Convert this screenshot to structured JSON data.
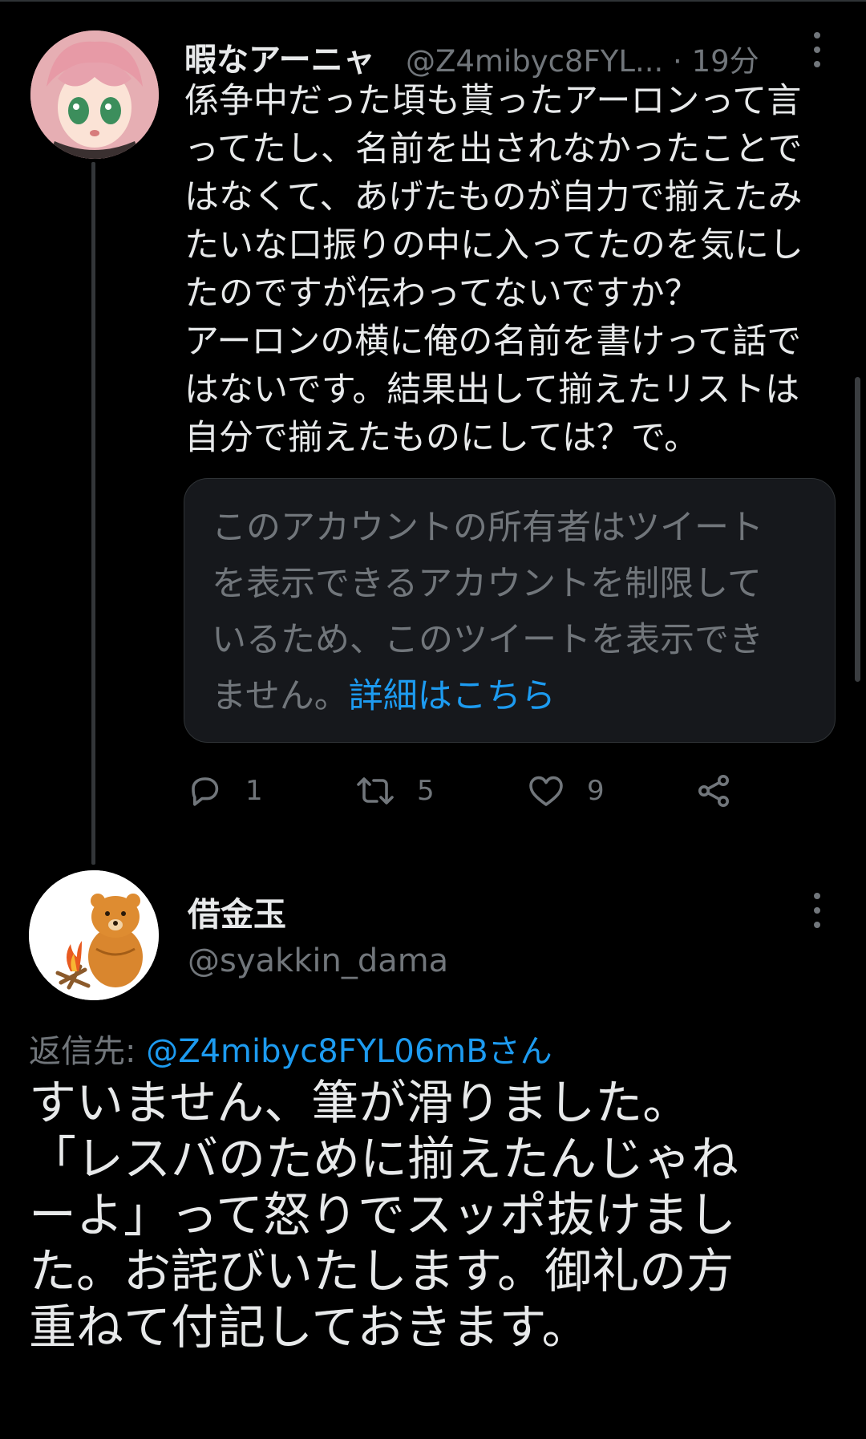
{
  "tweet1": {
    "display_name": "暇なアーニャ",
    "handle": "@Z4mibyc8FYL...",
    "separator": "·",
    "time": "19分",
    "text": "係争中だった頃も貰ったアーロンって言\nってたし、名前を出されなかったことで\nはなくて、あげたものが自力で揃えたみ\nたいな口振りの中に入ってたのを気にし\nたのですが伝わってないですか？\nアーロンの横に俺の名前を書けって話で\nはないです。結果出して揃えたリストは\n自分で揃えたものにしては？で。",
    "quoted_notice": "このアカウントの所有者はツイート\nを表示できるアカウントを制限して\nいるため、このツイートを表示でき\nません。",
    "quoted_link": "詳細はこちら",
    "actions": {
      "reply_count": "1",
      "retweet_count": "5",
      "like_count": "9"
    }
  },
  "tweet2": {
    "display_name": "借金玉",
    "handle": "@syakkin_dama",
    "reply_prefix": "返信先: ",
    "reply_to": "@Z4mibyc8FYL06mBさん",
    "text": "すいません、筆が滑りました。\n「レスバのために揃えたんじゃね\nーよ」って怒りでスッポ抜けまし\nた。お詫びいたします。御礼の方\n重ねて付記しておきます。"
  },
  "colors": {
    "background": "#000000",
    "text": "#e7e9ea",
    "secondary": "#71767b",
    "link": "#1d9bf0",
    "card": "#16181c"
  },
  "icons": [
    "more-icon",
    "reply-icon",
    "retweet-icon",
    "like-icon",
    "share-icon"
  ]
}
